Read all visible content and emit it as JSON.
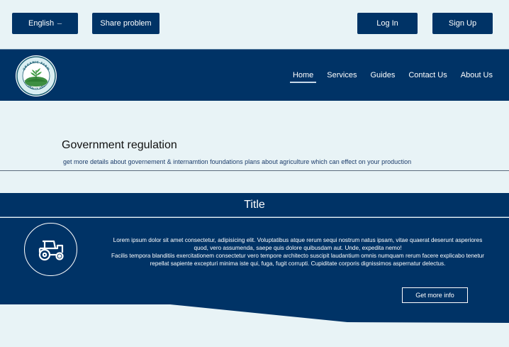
{
  "topbar": {
    "language_label": "English",
    "share_label": "Share problem",
    "login_label": "Log In",
    "signup_label": "Sign Up"
  },
  "logo": {
    "top_text": "ORGANIC FARM",
    "bottom_text": "NATURALLY GROWN"
  },
  "nav": {
    "items": [
      {
        "label": "Home",
        "active": true
      },
      {
        "label": "Services"
      },
      {
        "label": "Guides"
      },
      {
        "label": "Contact Us"
      },
      {
        "label": "About Us"
      }
    ]
  },
  "section": {
    "title": "Government regulation",
    "subtitle": "get more details about governement & internamtion foundations plans about agriculture which can effect on your production"
  },
  "card": {
    "title": "Title",
    "icon": "tractor-icon",
    "paragraph1": "Lorem ipsum dolor sit amet consectetur, adipisicing elit. Voluptatibus atque rerum sequi nostrum natus ipsam, vitae quaerat deserunt asperiores quod, vero assumenda, saepe quis dolore quibusdam aut. Unde, expedita nemo!",
    "paragraph2": "Facilis tempora blanditiis exercitationem consectetur vero tempore architecto suscipit laudantium omnis numquam rerum facere explicabo tenetur repellat sapiente excepturi minima iste qui, fuga, fugit corrupti. Cupiditate corporis dignissimos aspernatur delectus.",
    "button_label": "Get more info"
  },
  "colors": {
    "navy": "#003366",
    "background": "#e8f3f6"
  }
}
